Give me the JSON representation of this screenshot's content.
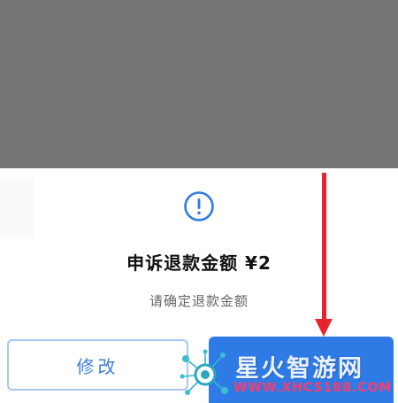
{
  "dialog": {
    "title": "申诉退款金额 ¥2",
    "subtitle": "请确定退款金额",
    "modify_label": "修改",
    "confirm_label": ""
  },
  "icons": {
    "info": "info-circle-icon"
  },
  "watermark": {
    "name": "星火智游网",
    "url": "WWW.XHCS188.COM"
  },
  "colors": {
    "overlay": "#767676",
    "accent": "#2f7be6",
    "arrow": "#e8232d",
    "watermark_url": "#ff3a6a"
  }
}
